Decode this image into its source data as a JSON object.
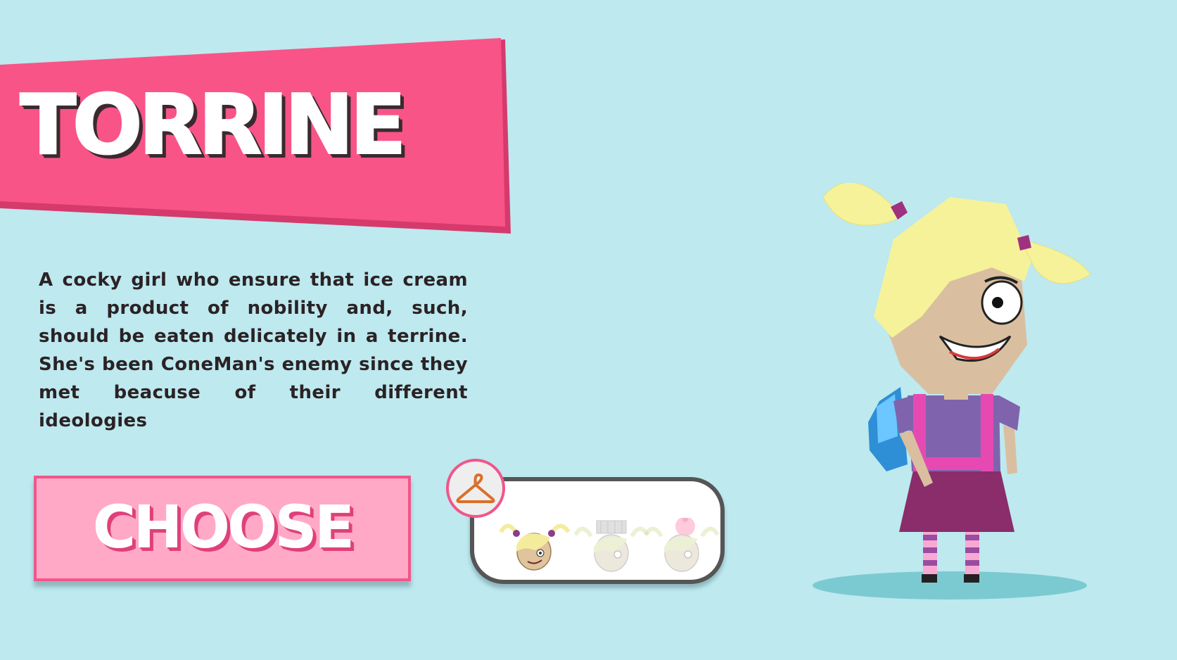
{
  "character": {
    "name": "TORRINE",
    "description": "A cocky girl who ensure that ice cream is a product of nobility and, such, should be eaten delicately in a terrine. She's been ConeMan's enemy since they met beacuse of their different ideologies"
  },
  "actions": {
    "choose_label": "CHOOSE"
  },
  "skins": {
    "icon": "hanger-icon",
    "options": [
      {
        "name": "skin-default",
        "selected": true
      },
      {
        "name": "skin-crown",
        "selected": false
      },
      {
        "name": "skin-icecream",
        "selected": false
      }
    ]
  },
  "colors": {
    "background": "#bde9ef",
    "banner": "#f95487",
    "banner_dark": "#d63a6c",
    "button": "#ffa9c6",
    "button_border": "#f2558a",
    "description_text": "#2b2224"
  }
}
